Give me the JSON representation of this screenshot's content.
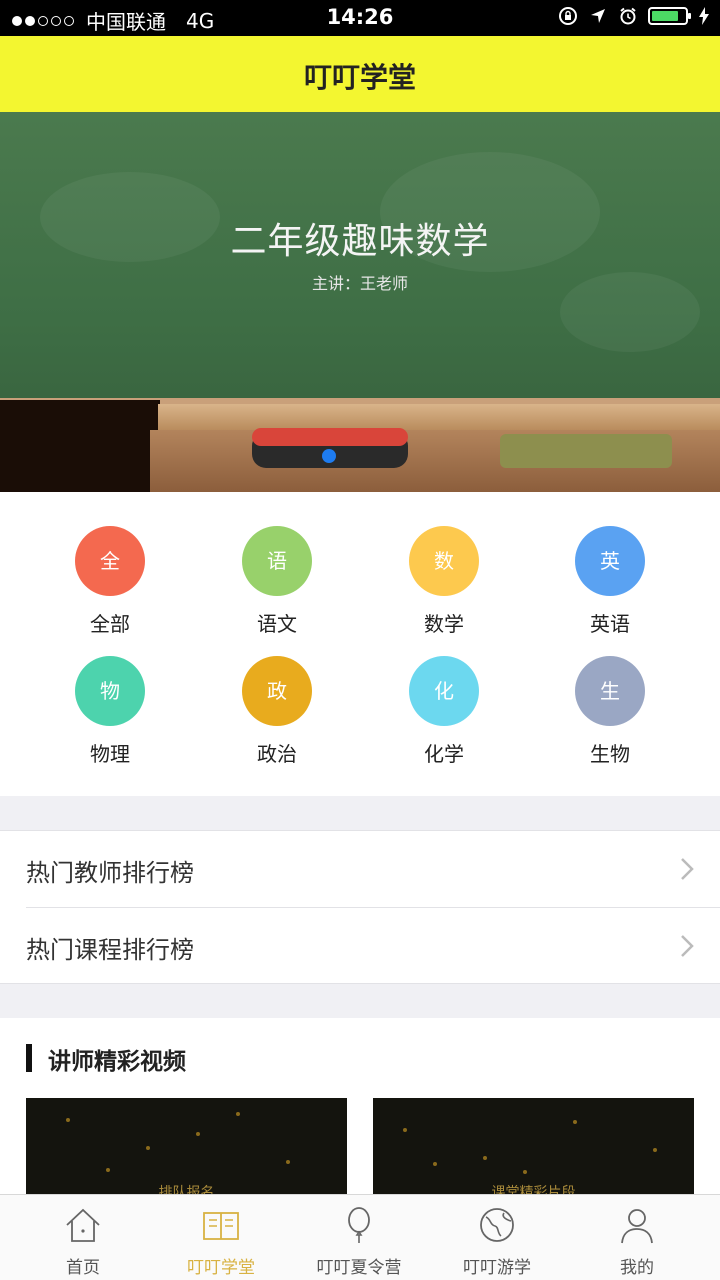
{
  "status_bar": {
    "carrier": "中国联通",
    "network": "4G",
    "time": "14:26"
  },
  "header": {
    "title": "叮叮学堂"
  },
  "banner": {
    "title": "二年级趣味数学",
    "subtitle": "主讲：王老师",
    "active_page": 1
  },
  "categories": [
    {
      "glyph": "全",
      "label": "全部",
      "color": "#f4694f"
    },
    {
      "glyph": "语",
      "label": "语文",
      "color": "#98d16b"
    },
    {
      "glyph": "数",
      "label": "数学",
      "color": "#fdc94e"
    },
    {
      "glyph": "英",
      "label": "英语",
      "color": "#5aa2f2"
    },
    {
      "glyph": "物",
      "label": "物理",
      "color": "#4dd3ad"
    },
    {
      "glyph": "政",
      "label": "政治",
      "color": "#e8ab1e"
    },
    {
      "glyph": "化",
      "label": "化学",
      "color": "#6cd8ef"
    },
    {
      "glyph": "生",
      "label": "生物",
      "color": "#9aa7c4"
    }
  ],
  "rankings": [
    {
      "label": "热门教师排行榜"
    },
    {
      "label": "热门课程排行榜"
    }
  ],
  "videos": {
    "section_title": "讲师精彩视频",
    "items": [
      {
        "caption": "排队报名"
      },
      {
        "caption": "课堂精彩片段"
      }
    ]
  },
  "tabbar": {
    "accent_color": "#d8b243",
    "items": [
      {
        "label": "首页",
        "icon": "home-icon"
      },
      {
        "label": "叮叮学堂",
        "icon": "book-icon",
        "active": true
      },
      {
        "label": "叮叮夏令营",
        "icon": "balloon-icon"
      },
      {
        "label": "叮叮游学",
        "icon": "globe-icon"
      },
      {
        "label": "我的",
        "icon": "user-icon"
      }
    ]
  }
}
